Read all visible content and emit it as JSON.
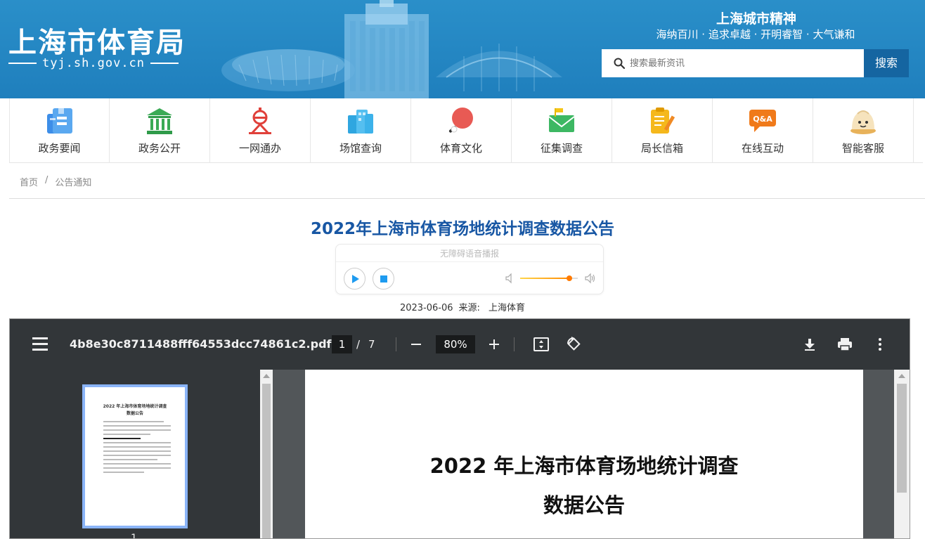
{
  "header": {
    "logo_text": "上海市体育局",
    "logo_url": "tyj.sh.gov.cn",
    "slogan_title": "上海城市精神",
    "slogan_sub": "海纳百川 · 追求卓越 · 开明睿智 · 大气谦和",
    "search_placeholder": "搜索最新资讯",
    "search_button": "搜索"
  },
  "nav": {
    "items": [
      {
        "label": "政务要闻",
        "icon": "news-icon"
      },
      {
        "label": "政务公开",
        "icon": "government-building-icon"
      },
      {
        "label": "一网通办",
        "icon": "one-net-service-icon"
      },
      {
        "label": "场馆查询",
        "icon": "venue-building-icon"
      },
      {
        "label": "体育文化",
        "icon": "table-tennis-icon"
      },
      {
        "label": "征集调查",
        "icon": "envelope-flag-icon"
      },
      {
        "label": "局长信箱",
        "icon": "clipboard-pencil-icon"
      },
      {
        "label": "在线互动",
        "icon": "qa-chat-icon"
      },
      {
        "label": "智能客服",
        "icon": "robot-bun-icon"
      }
    ]
  },
  "breadcrumb": {
    "home": "首页",
    "separator": "/",
    "current": "公告通知"
  },
  "article": {
    "title": "2022年上海市体育场地统计调查数据公告",
    "date": "2023-06-06",
    "source_label": "来源:",
    "source": "上海体育"
  },
  "audio": {
    "label": "无障碍语音播报",
    "volume": 0.85
  },
  "pdf": {
    "filename": "4b8e30c8711488fff64553dcc74861c2.pdf",
    "current_page": "1",
    "page_separator": "/",
    "total_pages": "7",
    "zoom": "80%",
    "thumb_title_line1": "2022 年上海市体育场地统计调查",
    "thumb_title_line2": "数据公告",
    "thumb_number": "1",
    "page_title_line1": "2022 年上海市体育场地统计调查",
    "page_title_line2": "数据公告"
  },
  "colors": {
    "header_blue": "#2a8fc9",
    "search_button": "#1565a1",
    "title_blue": "#1857a4",
    "pdf_toolbar": "#323639",
    "pdf_background": "#525659",
    "thumb_border": "#8ab4f8"
  }
}
